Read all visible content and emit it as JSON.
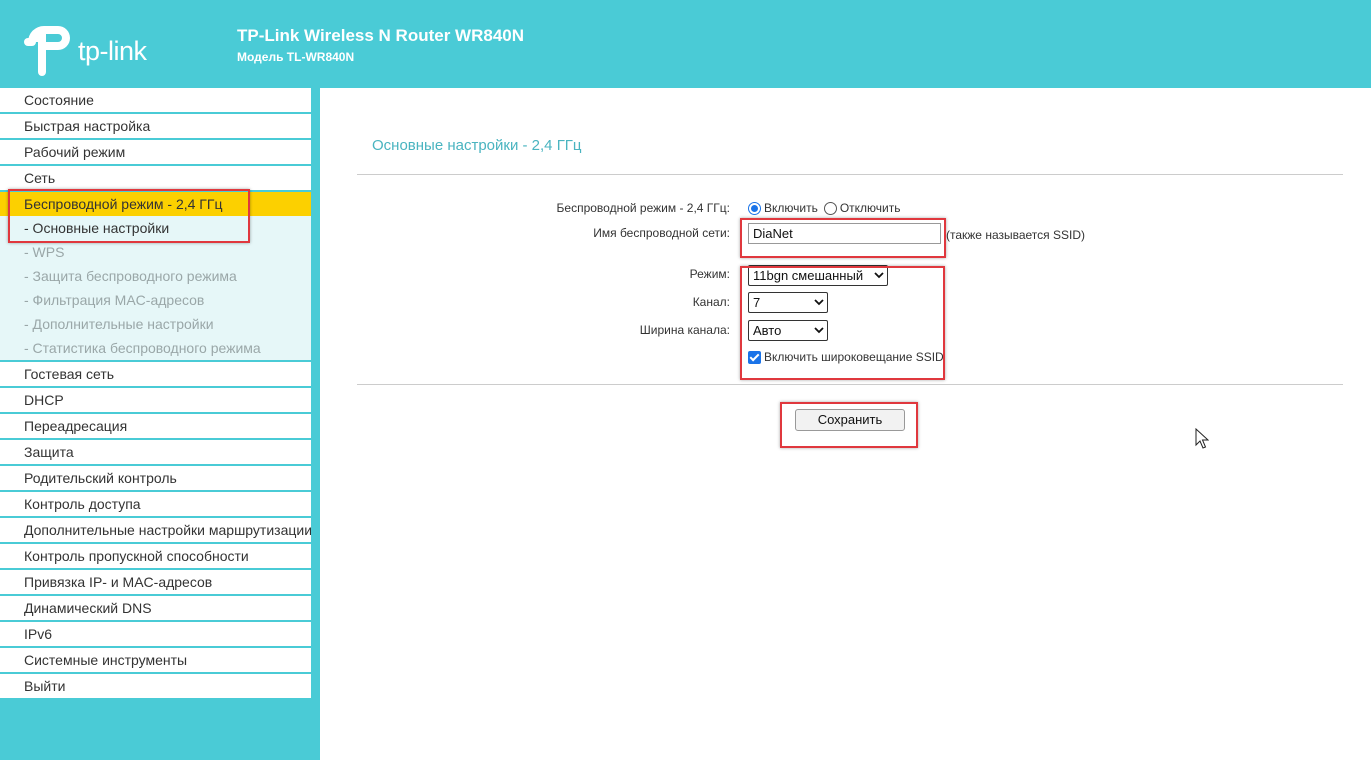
{
  "header": {
    "logo_text": "tp-link",
    "title": "TP-Link Wireless N Router WR840N",
    "model": "Модель TL-WR840N"
  },
  "sidebar": {
    "items_top": [
      {
        "label": "Состояние"
      },
      {
        "label": "Быстрая настройка"
      },
      {
        "label": "Рабочий режим"
      },
      {
        "label": "Сеть"
      }
    ],
    "active_item": {
      "label": "Беспроводной режим - 2,4 ГГц"
    },
    "sub_items": [
      {
        "label": "- Основные настройки"
      },
      {
        "label": "- WPS"
      },
      {
        "label": "- Защита беспроводного режима"
      },
      {
        "label": "- Фильтрация MAC-адресов"
      },
      {
        "label": "- Дополнительные настройки"
      },
      {
        "label": "- Статистика беспроводного режима"
      }
    ],
    "items_bottom": [
      {
        "label": "Гостевая сеть"
      },
      {
        "label": "DHCP"
      },
      {
        "label": "Переадресация"
      },
      {
        "label": "Защита"
      },
      {
        "label": "Родительский контроль"
      },
      {
        "label": "Контроль доступа"
      },
      {
        "label": "Дополнительные настройки маршрутизации"
      },
      {
        "label": "Контроль пропускной способности"
      },
      {
        "label": "Привязка IP- и MAC-адресов"
      },
      {
        "label": "Динамический DNS"
      },
      {
        "label": "IPv6"
      },
      {
        "label": "Системные инструменты"
      },
      {
        "label": "Выйти"
      }
    ]
  },
  "main": {
    "section_title": "Основные настройки - 2,4 ГГц",
    "wireless_mode": {
      "label": "Беспроводной режим - 2,4 ГГц:",
      "option_on": "Включить",
      "option_off": "Отключить",
      "selected": "Включить"
    },
    "ssid": {
      "label": "Имя беспроводной сети:",
      "value": "DiaNet",
      "hint": "(также называется SSID)"
    },
    "mode": {
      "label": "Режим:",
      "value": "11bgn смешанный"
    },
    "channel": {
      "label": "Канал:",
      "value": "7"
    },
    "channel_width": {
      "label": "Ширина канала:",
      "value": "Авто"
    },
    "broadcast_ssid": {
      "label": "Включить широковещание SSID",
      "checked": true
    },
    "save_label": "Сохранить"
  },
  "colors": {
    "brand_teal": "#4acbd6",
    "active_yellow": "#fcd000",
    "title_teal": "#4ab4c0",
    "highlight_red": "#e0383e"
  }
}
